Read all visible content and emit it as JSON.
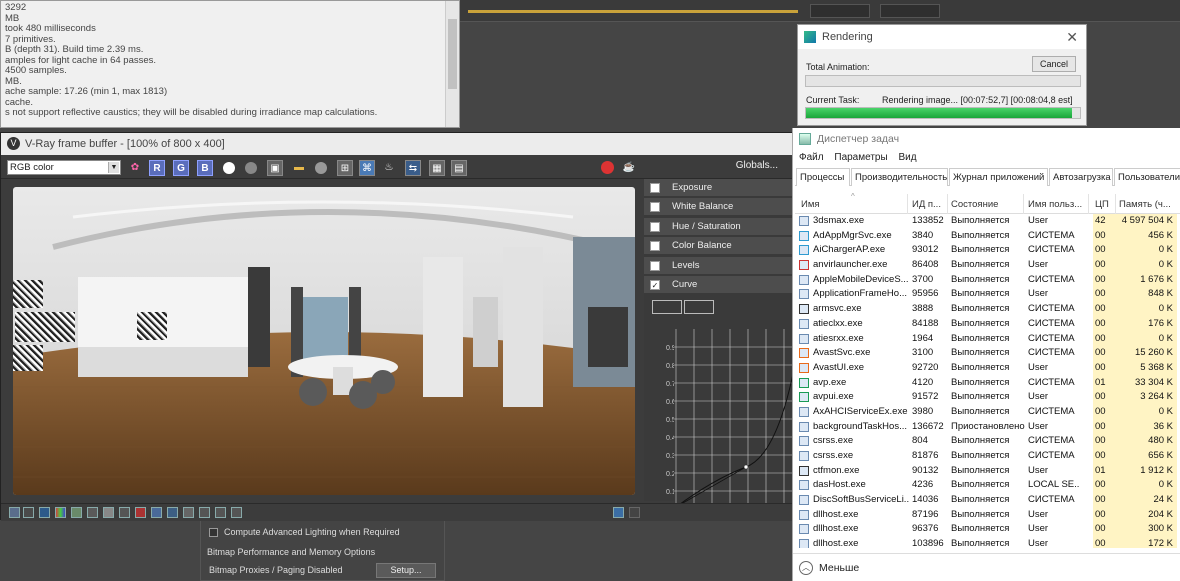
{
  "log": {
    "lines": [
      "3292",
      "MB",
      " took 480 milliseconds",
      "7 primitives.",
      "B (depth 31). Build time 2.39 ms.",
      "amples for light cache in 64 passes.",
      "4500 samples.",
      "MB.",
      "ache sample: 17.26 (min 1, max 1813)",
      "cache.",
      "s not support reflective caustics; they will be disabled during irradiance map calculations."
    ]
  },
  "maxpanel": {
    "compute_label": "Compute Advanced Lighting when Required",
    "group_label": "Bitmap Performance and Memory Options",
    "proxies_label": "Bitmap Proxies / Paging Disabled",
    "setup_button": "Setup..."
  },
  "vfb": {
    "title": "V-Ray frame buffer - [100% of 800 x 400]",
    "channel": "RGB color",
    "r": "R",
    "g": "G",
    "b": "B",
    "globals": "Globals...",
    "corrections": [
      {
        "label": "Exposure",
        "checked": ""
      },
      {
        "label": "White Balance",
        "checked": ""
      },
      {
        "label": "Hue / Saturation",
        "checked": ""
      },
      {
        "label": "Color Balance",
        "checked": ""
      },
      {
        "label": "Levels",
        "checked": ""
      },
      {
        "label": "Curve",
        "checked": "✓"
      }
    ],
    "curve_y_labels": [
      "0.9",
      "0.8",
      "0.7",
      "0.6",
      "0.5",
      "0.4",
      "0.3",
      "0.2",
      "0.1",
      "0.0"
    ]
  },
  "rendering": {
    "title": "Rendering",
    "cancel": "Cancel",
    "total_label": "Total Animation:",
    "task_label": "Current Task:",
    "task_text": "Rendering image... [00:07:52,7] [00:08:04,8 est]",
    "task_progress": 0.97,
    "total_progress": 0
  },
  "taskmgr": {
    "title": "Диспетчер задач",
    "menu": [
      "Файл",
      "Параметры",
      "Вид"
    ],
    "tabs": [
      "Процессы",
      "Производительность",
      "Журнал приложений",
      "Автозагрузка",
      "Пользователи"
    ],
    "columns": {
      "name": "Имя",
      "pid": "ИД п...",
      "state": "Состояние",
      "user": "Имя польз...",
      "cpu": "ЦП",
      "mem": "Память (ч..."
    },
    "rows": [
      {
        "name": "3dsmax.exe",
        "pid": "133852",
        "state": "Выполняется",
        "user": "User",
        "cpu": "42",
        "mem": "4 597 504 K"
      },
      {
        "name": "AdAppMgrSvc.exe",
        "pid": "3840",
        "state": "Выполняется",
        "user": "СИСТЕМА",
        "cpu": "00",
        "mem": "456 K"
      },
      {
        "name": "AiChargerAP.exe",
        "pid": "93012",
        "state": "Выполняется",
        "user": "СИСТЕМА",
        "cpu": "00",
        "mem": "0 K"
      },
      {
        "name": "anvirlauncher.exe",
        "pid": "86408",
        "state": "Выполняется",
        "user": "User",
        "cpu": "00",
        "mem": "0 K"
      },
      {
        "name": "AppleMobileDeviceS...",
        "pid": "3700",
        "state": "Выполняется",
        "user": "СИСТЕМА",
        "cpu": "00",
        "mem": "1 676 K"
      },
      {
        "name": "ApplicationFrameHo...",
        "pid": "95956",
        "state": "Выполняется",
        "user": "User",
        "cpu": "00",
        "mem": "848 K"
      },
      {
        "name": "armsvc.exe",
        "pid": "3888",
        "state": "Выполняется",
        "user": "СИСТЕМА",
        "cpu": "00",
        "mem": "0 K"
      },
      {
        "name": "atieclxx.exe",
        "pid": "84188",
        "state": "Выполняется",
        "user": "СИСТЕМА",
        "cpu": "00",
        "mem": "176 K"
      },
      {
        "name": "atiesrxx.exe",
        "pid": "1964",
        "state": "Выполняется",
        "user": "СИСТЕМА",
        "cpu": "00",
        "mem": "0 K"
      },
      {
        "name": "AvastSvc.exe",
        "pid": "3100",
        "state": "Выполняется",
        "user": "СИСТЕМА",
        "cpu": "00",
        "mem": "15 260 K"
      },
      {
        "name": "AvastUI.exe",
        "pid": "92720",
        "state": "Выполняется",
        "user": "User",
        "cpu": "00",
        "mem": "5 368 K"
      },
      {
        "name": "avp.exe",
        "pid": "4120",
        "state": "Выполняется",
        "user": "СИСТЕМА",
        "cpu": "01",
        "mem": "33 304 K"
      },
      {
        "name": "avpui.exe",
        "pid": "91572",
        "state": "Выполняется",
        "user": "User",
        "cpu": "00",
        "mem": "3 264 K"
      },
      {
        "name": "AxAHCIServiceEx.exe",
        "pid": "3980",
        "state": "Выполняется",
        "user": "СИСТЕМА",
        "cpu": "00",
        "mem": "0 K"
      },
      {
        "name": "backgroundTaskHos...",
        "pid": "136672",
        "state": "Приостановлено",
        "user": "User",
        "cpu": "00",
        "mem": "36 K"
      },
      {
        "name": "csrss.exe",
        "pid": "804",
        "state": "Выполняется",
        "user": "СИСТЕМА",
        "cpu": "00",
        "mem": "480 K"
      },
      {
        "name": "csrss.exe",
        "pid": "81876",
        "state": "Выполняется",
        "user": "СИСТЕМА",
        "cpu": "00",
        "mem": "656 K"
      },
      {
        "name": "ctfmon.exe",
        "pid": "90132",
        "state": "Выполняется",
        "user": "User",
        "cpu": "01",
        "mem": "1 912 K"
      },
      {
        "name": "dasHost.exe",
        "pid": "4236",
        "state": "Выполняется",
        "user": "LOCAL SE...",
        "cpu": "00",
        "mem": "0 K"
      },
      {
        "name": "DiscSoftBusServiceLi...",
        "pid": "14036",
        "state": "Выполняется",
        "user": "СИСТЕМА",
        "cpu": "00",
        "mem": "24 K"
      },
      {
        "name": "dllhost.exe",
        "pid": "87196",
        "state": "Выполняется",
        "user": "User",
        "cpu": "00",
        "mem": "204 K"
      },
      {
        "name": "dllhost.exe",
        "pid": "96376",
        "state": "Выполняется",
        "user": "User",
        "cpu": "00",
        "mem": "300 K"
      },
      {
        "name": "dllhost.exe",
        "pid": "103896",
        "state": "Выполняется",
        "user": "User",
        "cpu": "00",
        "mem": "172 K"
      }
    ],
    "fewer": "Меньше"
  }
}
